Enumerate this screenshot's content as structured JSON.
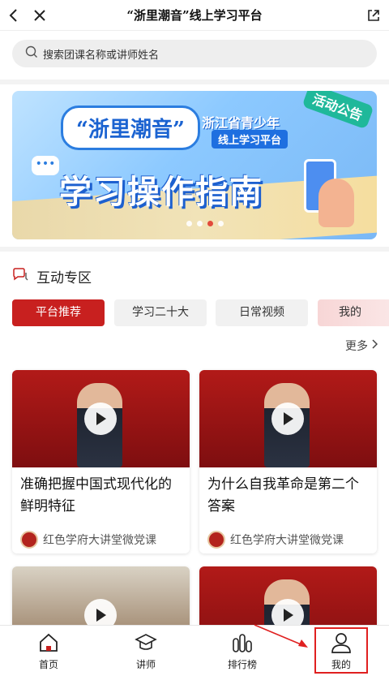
{
  "header": {
    "title": "“浙里潮音”线上学习平台"
  },
  "search": {
    "placeholder": "搜索团课名称或讲师姓名"
  },
  "banner": {
    "brand": "“浙里潮音”",
    "line1": "浙江省青少年",
    "line2": "线上学习平台",
    "tag": "活动公告",
    "headline": "学习操作指南",
    "active_dot": 3,
    "dot_count": 4
  },
  "zone": {
    "title": "互动专区",
    "tabs": [
      "平台推荐",
      "学习二十大",
      "日常视频",
      "我的"
    ],
    "active_tab": 0,
    "more": "更多"
  },
  "cards": [
    {
      "title": "准确把握中国式现代化的鲜明特征",
      "source": "红色学府大讲堂微党课"
    },
    {
      "title": "为什么自我革命是第二个答案",
      "source": "红色学府大讲堂微党课"
    },
    {
      "title": "",
      "source": ""
    },
    {
      "title": "",
      "source": ""
    }
  ],
  "bottom_nav": [
    {
      "label": "首页",
      "icon": "home-icon"
    },
    {
      "label": "讲师",
      "icon": "graduation-cap-icon"
    },
    {
      "label": "排行榜",
      "icon": "ranking-bars-icon"
    },
    {
      "label": "我的",
      "icon": "user-icon"
    }
  ],
  "colors": {
    "accent": "#c8201f",
    "highlight": "#e02020"
  }
}
